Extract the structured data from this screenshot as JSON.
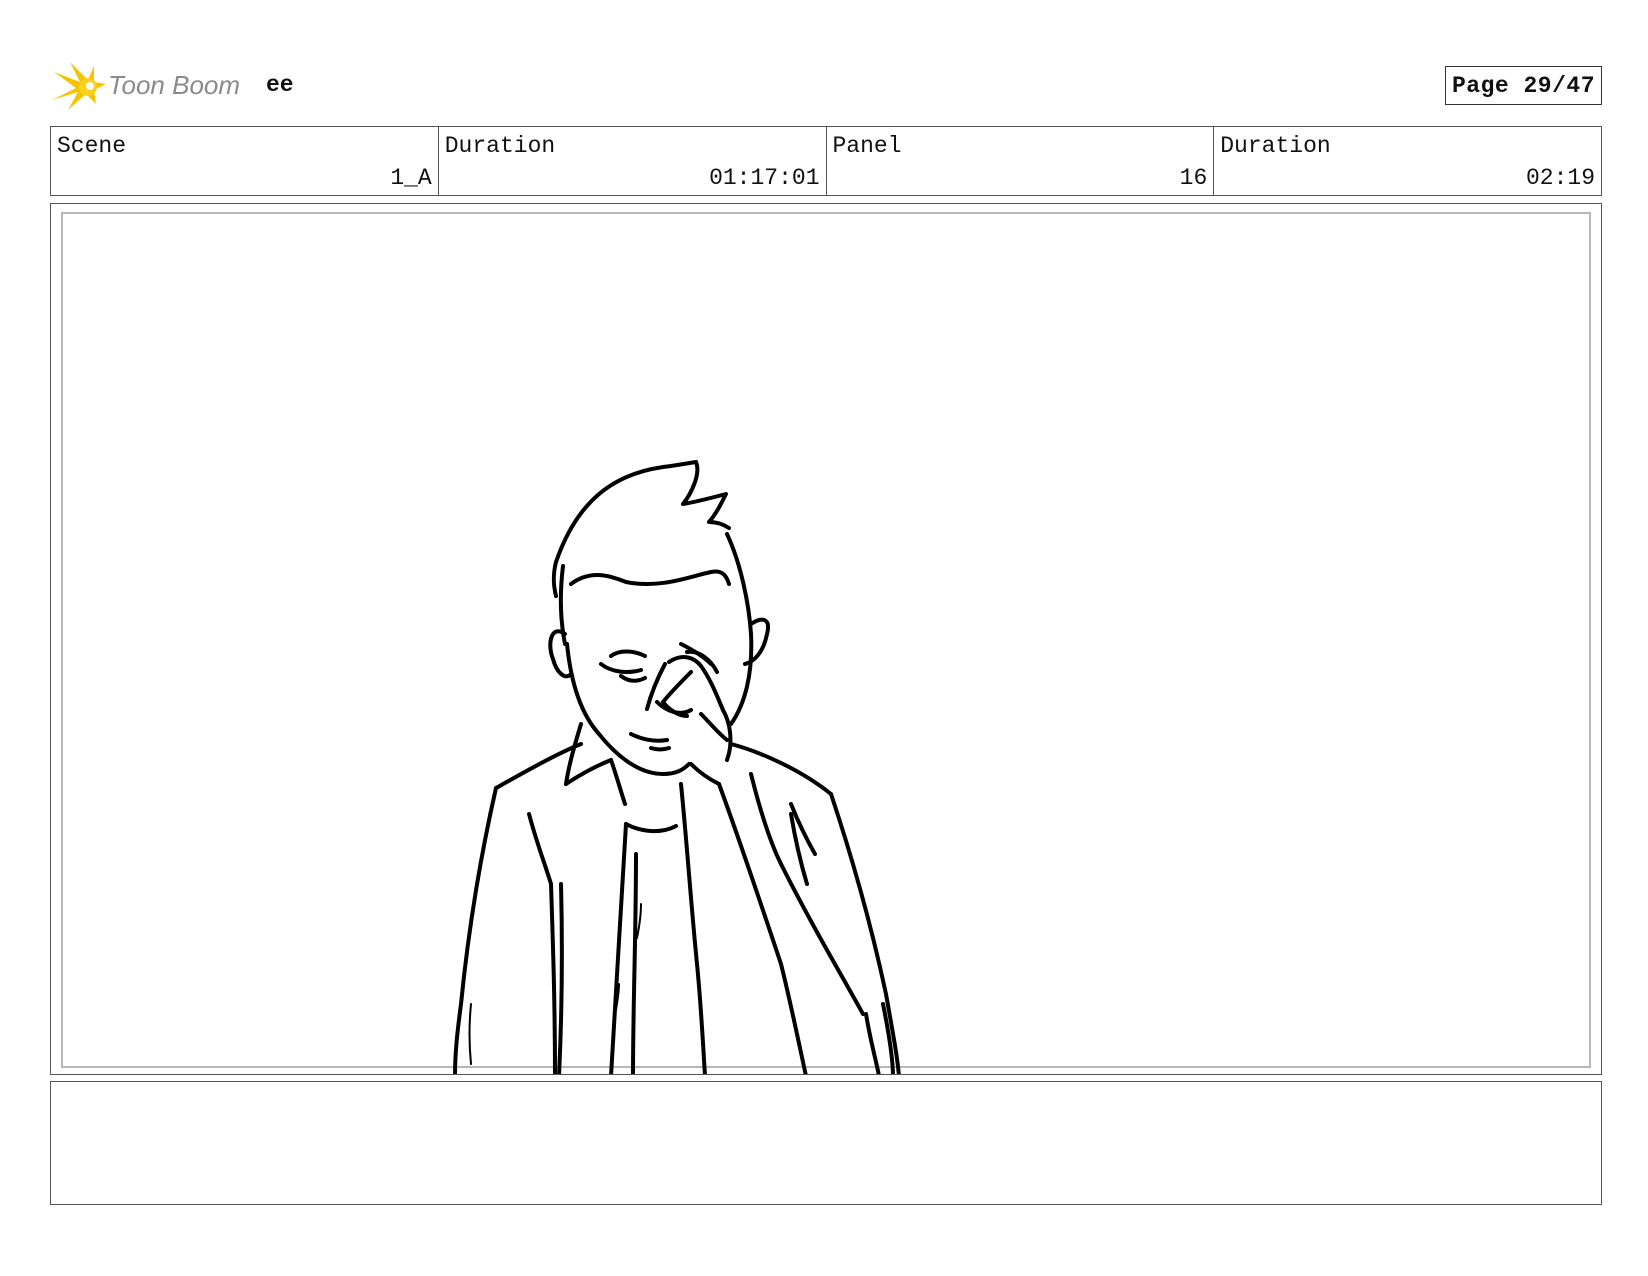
{
  "header": {
    "logo_text": "Toon Boom",
    "project_name": "ee",
    "page_label": "Page 29/47"
  },
  "info": [
    {
      "label": "Scene",
      "value": "1_A"
    },
    {
      "label": "Duration",
      "value": "01:17:01"
    },
    {
      "label": "Panel",
      "value": "16"
    },
    {
      "label": "Duration",
      "value": "02:19"
    }
  ],
  "panel": {
    "sketch_subject": "man-rubbing-eyes-sketch"
  },
  "notes": {
    "text": ""
  },
  "colors": {
    "logo_yellow": "#f5c400",
    "logo_gray": "#8a8a8a",
    "border": "#555555",
    "inner_border": "#b7b7b7"
  }
}
